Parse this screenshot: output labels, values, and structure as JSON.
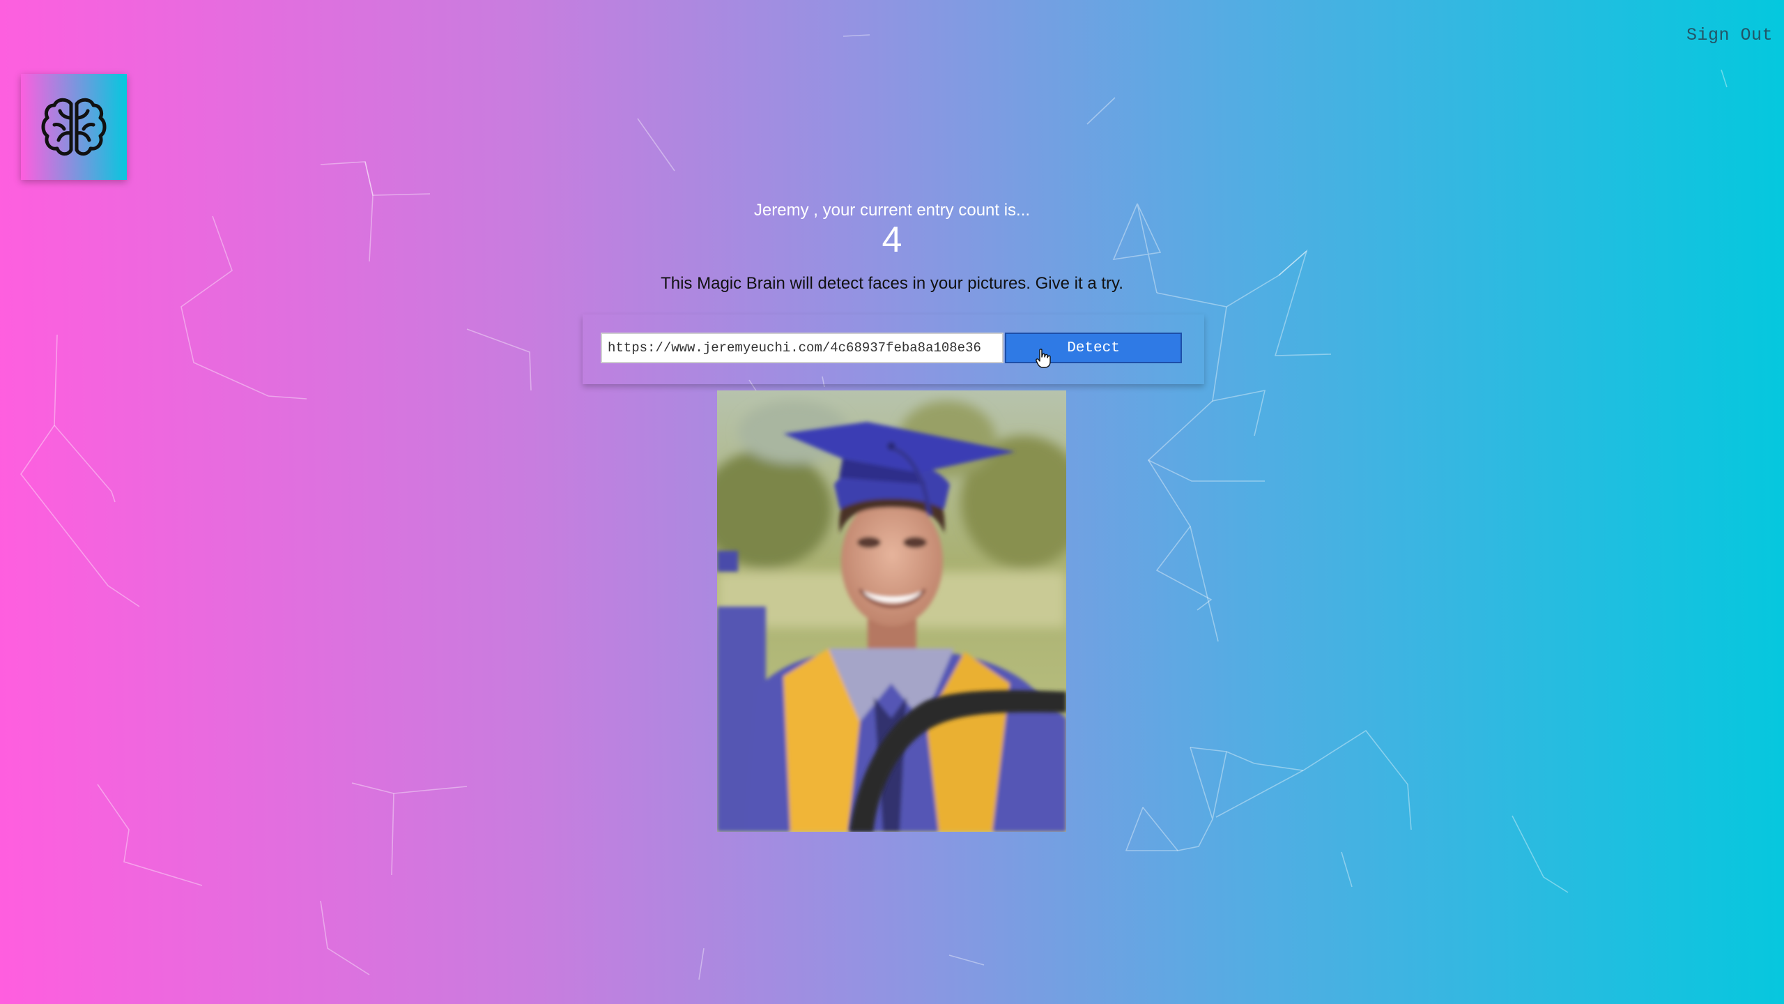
{
  "header": {
    "sign_out_label": "Sign Out"
  },
  "logo": {
    "icon": "brain-icon"
  },
  "rank": {
    "message": "Jeremy , your current entry count is...",
    "count": "4"
  },
  "tagline": "This Magic Brain will detect faces in your pictures. Give it a try.",
  "form": {
    "url_value": "https://www.jeremyeuchi.com/4c68937feba8a108e36",
    "button_label": "Detect"
  },
  "image": {
    "content": "graduate-portrait"
  },
  "colors": {
    "gradient_start": "#ff5edf",
    "gradient_end": "#04c8de",
    "button": "#2f7ae5",
    "button_border": "#1d4fa8"
  }
}
